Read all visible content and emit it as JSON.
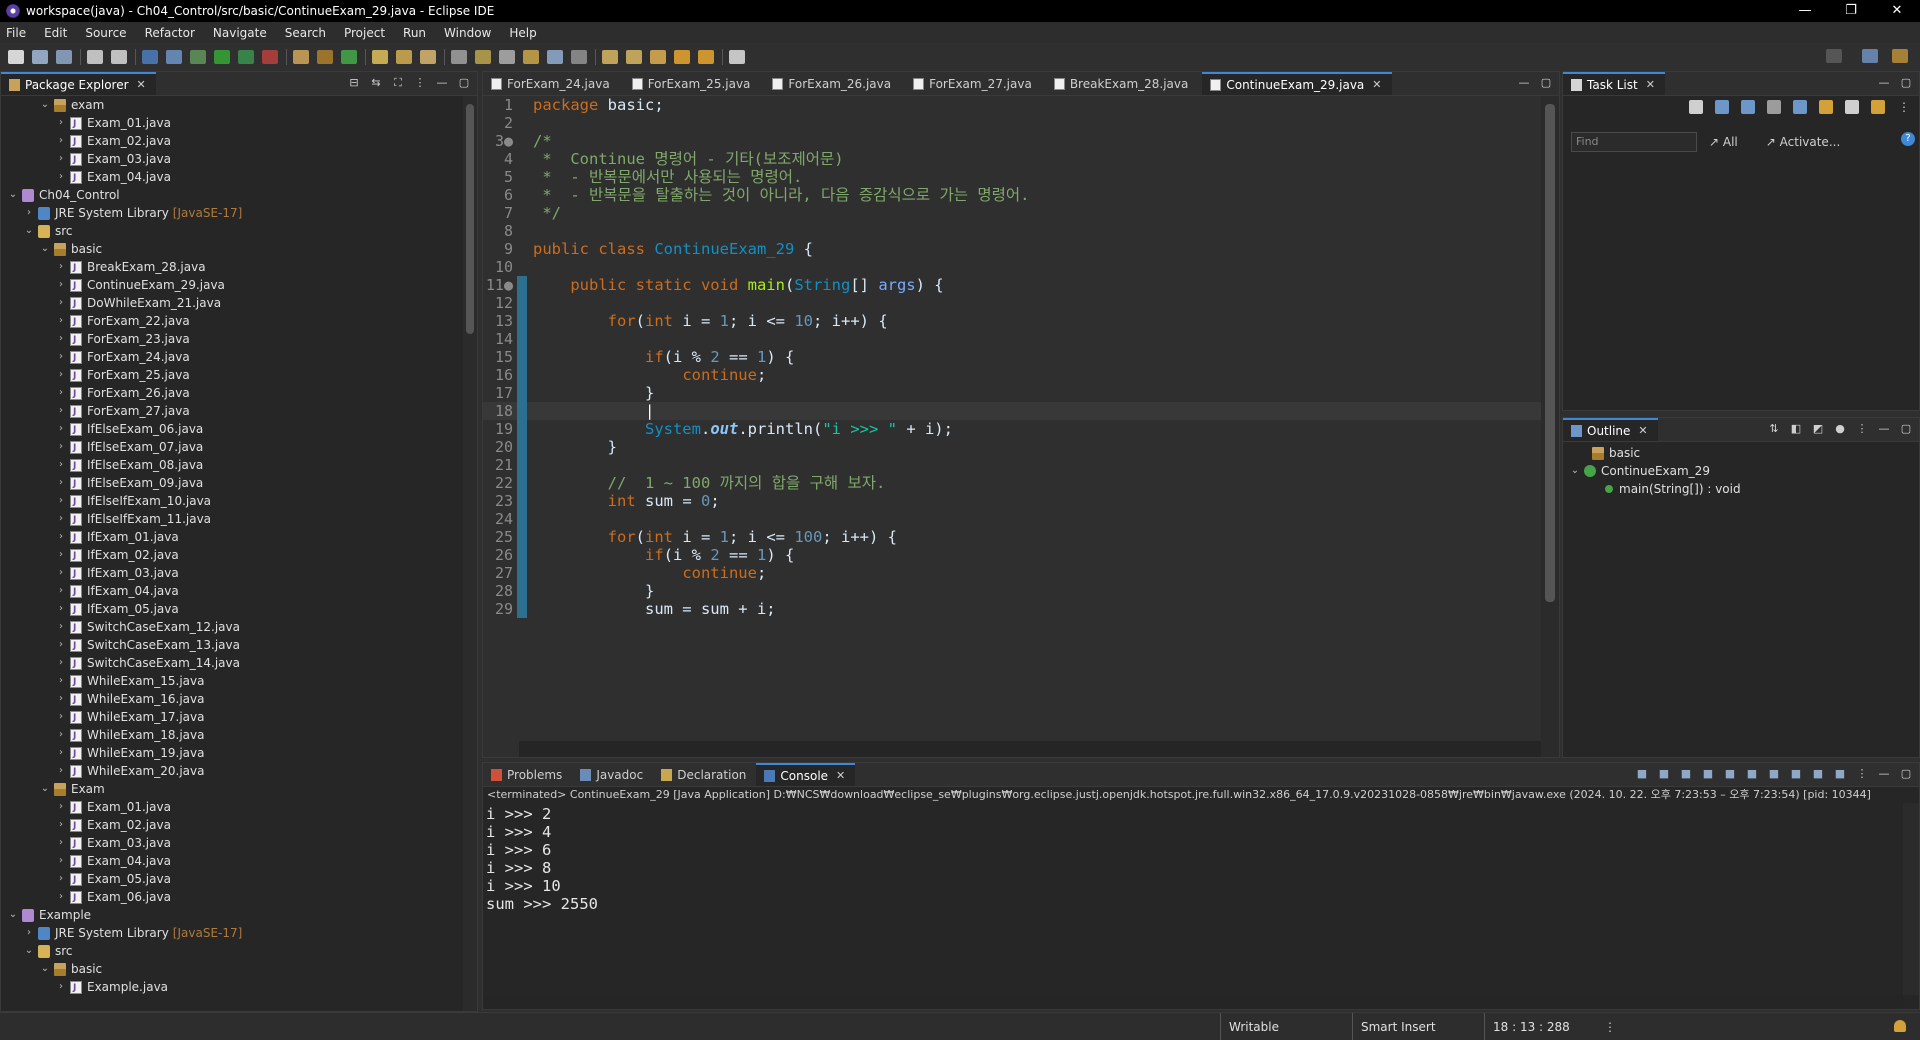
{
  "window": {
    "title": "workspace(java) - Ch04_Control/src/basic/ContinueExam_29.java - Eclipse IDE",
    "minimize": "—",
    "maximize": "❐",
    "close": "✕"
  },
  "menu": [
    "File",
    "Edit",
    "Source",
    "Refactor",
    "Navigate",
    "Search",
    "Project",
    "Run",
    "Window",
    "Help"
  ],
  "package_explorer": {
    "tab_label": "Package Explorer",
    "tree": [
      {
        "indent": 2,
        "arrow": "⌄",
        "icon": "pkg",
        "label": "exam"
      },
      {
        "indent": 3,
        "arrow": "›",
        "icon": "java",
        "label": "Exam_01.java"
      },
      {
        "indent": 3,
        "arrow": "›",
        "icon": "java",
        "label": "Exam_02.java"
      },
      {
        "indent": 3,
        "arrow": "›",
        "icon": "java",
        "label": "Exam_03.java"
      },
      {
        "indent": 3,
        "arrow": "›",
        "icon": "java",
        "label": "Exam_04.java"
      },
      {
        "indent": 0,
        "arrow": "⌄",
        "icon": "proj",
        "label": "Ch04_Control"
      },
      {
        "indent": 1,
        "arrow": "›",
        "icon": "jre",
        "label": "JRE System Library",
        "deco": "[JavaSE-17]"
      },
      {
        "indent": 1,
        "arrow": "⌄",
        "icon": "src",
        "label": "src"
      },
      {
        "indent": 2,
        "arrow": "⌄",
        "icon": "pkg",
        "label": "basic"
      },
      {
        "indent": 3,
        "arrow": "›",
        "icon": "java",
        "label": "BreakExam_28.java"
      },
      {
        "indent": 3,
        "arrow": "›",
        "icon": "java",
        "label": "ContinueExam_29.java"
      },
      {
        "indent": 3,
        "arrow": "›",
        "icon": "java",
        "label": "DoWhileExam_21.java"
      },
      {
        "indent": 3,
        "arrow": "›",
        "icon": "java",
        "label": "ForExam_22.java"
      },
      {
        "indent": 3,
        "arrow": "›",
        "icon": "java",
        "label": "ForExam_23.java"
      },
      {
        "indent": 3,
        "arrow": "›",
        "icon": "java",
        "label": "ForExam_24.java"
      },
      {
        "indent": 3,
        "arrow": "›",
        "icon": "java",
        "label": "ForExam_25.java"
      },
      {
        "indent": 3,
        "arrow": "›",
        "icon": "java",
        "label": "ForExam_26.java"
      },
      {
        "indent": 3,
        "arrow": "›",
        "icon": "java",
        "label": "ForExam_27.java"
      },
      {
        "indent": 3,
        "arrow": "›",
        "icon": "java",
        "label": "IfElseExam_06.java"
      },
      {
        "indent": 3,
        "arrow": "›",
        "icon": "java",
        "label": "IfElseExam_07.java"
      },
      {
        "indent": 3,
        "arrow": "›",
        "icon": "java",
        "label": "IfElseExam_08.java"
      },
      {
        "indent": 3,
        "arrow": "›",
        "icon": "java",
        "label": "IfElseExam_09.java"
      },
      {
        "indent": 3,
        "arrow": "›",
        "icon": "java",
        "label": "IfElseIfExam_10.java"
      },
      {
        "indent": 3,
        "arrow": "›",
        "icon": "java",
        "label": "IfElseIfExam_11.java"
      },
      {
        "indent": 3,
        "arrow": "›",
        "icon": "java",
        "label": "IfExam_01.java"
      },
      {
        "indent": 3,
        "arrow": "›",
        "icon": "java",
        "label": "IfExam_02.java"
      },
      {
        "indent": 3,
        "arrow": "›",
        "icon": "java",
        "label": "IfExam_03.java"
      },
      {
        "indent": 3,
        "arrow": "›",
        "icon": "java",
        "label": "IfExam_04.java"
      },
      {
        "indent": 3,
        "arrow": "›",
        "icon": "java",
        "label": "IfExam_05.java"
      },
      {
        "indent": 3,
        "arrow": "›",
        "icon": "java",
        "label": "SwitchCaseExam_12.java"
      },
      {
        "indent": 3,
        "arrow": "›",
        "icon": "java",
        "label": "SwitchCaseExam_13.java"
      },
      {
        "indent": 3,
        "arrow": "›",
        "icon": "java",
        "label": "SwitchCaseExam_14.java"
      },
      {
        "indent": 3,
        "arrow": "›",
        "icon": "java",
        "label": "WhileExam_15.java"
      },
      {
        "indent": 3,
        "arrow": "›",
        "icon": "java",
        "label": "WhileExam_16.java"
      },
      {
        "indent": 3,
        "arrow": "›",
        "icon": "java",
        "label": "WhileExam_17.java"
      },
      {
        "indent": 3,
        "arrow": "›",
        "icon": "java",
        "label": "WhileExam_18.java"
      },
      {
        "indent": 3,
        "arrow": "›",
        "icon": "java",
        "label": "WhileExam_19.java"
      },
      {
        "indent": 3,
        "arrow": "›",
        "icon": "java",
        "label": "WhileExam_20.java"
      },
      {
        "indent": 2,
        "arrow": "⌄",
        "icon": "pkg",
        "label": "Exam"
      },
      {
        "indent": 3,
        "arrow": "›",
        "icon": "java",
        "label": "Exam_01.java"
      },
      {
        "indent": 3,
        "arrow": "›",
        "icon": "java",
        "label": "Exam_02.java"
      },
      {
        "indent": 3,
        "arrow": "›",
        "icon": "java",
        "label": "Exam_03.java"
      },
      {
        "indent": 3,
        "arrow": "›",
        "icon": "java",
        "label": "Exam_04.java"
      },
      {
        "indent": 3,
        "arrow": "›",
        "icon": "java",
        "label": "Exam_05.java"
      },
      {
        "indent": 3,
        "arrow": "›",
        "icon": "java",
        "label": "Exam_06.java"
      },
      {
        "indent": 0,
        "arrow": "⌄",
        "icon": "proj",
        "label": "Example"
      },
      {
        "indent": 1,
        "arrow": "›",
        "icon": "jre",
        "label": "JRE System Library",
        "deco": "[JavaSE-17]"
      },
      {
        "indent": 1,
        "arrow": "⌄",
        "icon": "src",
        "label": "src"
      },
      {
        "indent": 2,
        "arrow": "⌄",
        "icon": "pkg",
        "label": "basic"
      },
      {
        "indent": 3,
        "arrow": "›",
        "icon": "java",
        "label": "Example.java"
      }
    ]
  },
  "editor": {
    "tabs": [
      {
        "label": "ForExam_24.java",
        "active": false
      },
      {
        "label": "ForExam_25.java",
        "active": false
      },
      {
        "label": "ForExam_26.java",
        "active": false
      },
      {
        "label": "ForExam_27.java",
        "active": false
      },
      {
        "label": "BreakExam_28.java",
        "active": false
      },
      {
        "label": "ContinueExam_29.java",
        "active": true
      }
    ],
    "lines": [
      {
        "n": "1",
        "tokens": [
          [
            "kw",
            "package"
          ],
          [
            "t",
            " basic;"
          ]
        ]
      },
      {
        "n": "2",
        "tokens": []
      },
      {
        "n": "3●",
        "tokens": [
          [
            "cm",
            "/*"
          ]
        ]
      },
      {
        "n": "4",
        "tokens": [
          [
            "cm",
            " *  Continue 명령어 - 기타(보조제어문)"
          ]
        ]
      },
      {
        "n": "5",
        "tokens": [
          [
            "cm",
            " *  - 반복문에서만 사용되는 명령어."
          ]
        ]
      },
      {
        "n": "6",
        "tokens": [
          [
            "cm",
            " *  - 반복문을 탈출하는 것이 아니라, 다음 증감식으로 가는 명령어."
          ]
        ]
      },
      {
        "n": "7",
        "tokens": [
          [
            "cm",
            " */"
          ]
        ]
      },
      {
        "n": "8",
        "tokens": []
      },
      {
        "n": "9",
        "tokens": [
          [
            "kw",
            "public class "
          ],
          [
            "cls",
            "ContinueExam_29"
          ],
          [
            "t",
            " {"
          ]
        ]
      },
      {
        "n": "10",
        "tokens": []
      },
      {
        "n": "11●",
        "tokens": [
          [
            "t",
            "    "
          ],
          [
            "kw",
            "public static void "
          ],
          [
            "fn",
            "main"
          ],
          [
            "t",
            "("
          ],
          [
            "cls",
            "String"
          ],
          [
            "t",
            "[] "
          ],
          [
            "var",
            "args"
          ],
          [
            "t",
            ") {"
          ]
        ]
      },
      {
        "n": "12",
        "tokens": []
      },
      {
        "n": "13",
        "tokens": [
          [
            "t",
            "        "
          ],
          [
            "kw",
            "for"
          ],
          [
            "t",
            "("
          ],
          [
            "kw",
            "int"
          ],
          [
            "t",
            " i = "
          ],
          [
            "num",
            "1"
          ],
          [
            "t",
            "; i <= "
          ],
          [
            "num",
            "10"
          ],
          [
            "t",
            "; i++) {"
          ]
        ]
      },
      {
        "n": "14",
        "tokens": []
      },
      {
        "n": "15",
        "tokens": [
          [
            "t",
            "            "
          ],
          [
            "kw",
            "if"
          ],
          [
            "t",
            "(i % "
          ],
          [
            "num",
            "2"
          ],
          [
            "t",
            " == "
          ],
          [
            "num",
            "1"
          ],
          [
            "t",
            ") {"
          ]
        ]
      },
      {
        "n": "16",
        "tokens": [
          [
            "t",
            "                "
          ],
          [
            "kw",
            "continue"
          ],
          [
            "t",
            ";"
          ]
        ]
      },
      {
        "n": "17",
        "tokens": [
          [
            "t",
            "            }"
          ]
        ]
      },
      {
        "n": "18",
        "tokens": [
          [
            "t",
            "            "
          ],
          [
            "cursor",
            "|"
          ]
        ],
        "current": true
      },
      {
        "n": "19",
        "tokens": [
          [
            "t",
            "            "
          ],
          [
            "cls",
            "System"
          ],
          [
            "t",
            "."
          ],
          [
            "field",
            "out"
          ],
          [
            "t",
            ".println("
          ],
          [
            "str",
            "\"i >>> \""
          ],
          [
            "t",
            " + i);"
          ]
        ]
      },
      {
        "n": "20",
        "tokens": [
          [
            "t",
            "        }"
          ]
        ]
      },
      {
        "n": "21",
        "tokens": []
      },
      {
        "n": "22",
        "tokens": [
          [
            "t",
            "        "
          ],
          [
            "cm",
            "//  1 ~ 100 까지의 합을 구해 보자."
          ]
        ]
      },
      {
        "n": "23",
        "tokens": [
          [
            "t",
            "        "
          ],
          [
            "kw",
            "int"
          ],
          [
            "t",
            " sum = "
          ],
          [
            "num",
            "0"
          ],
          [
            "t",
            ";"
          ]
        ]
      },
      {
        "n": "24",
        "tokens": []
      },
      {
        "n": "25",
        "tokens": [
          [
            "t",
            "        "
          ],
          [
            "kw",
            "for"
          ],
          [
            "t",
            "("
          ],
          [
            "kw",
            "int"
          ],
          [
            "t",
            " i = "
          ],
          [
            "num",
            "1"
          ],
          [
            "t",
            "; i <= "
          ],
          [
            "num",
            "100"
          ],
          [
            "t",
            "; i++) {"
          ]
        ]
      },
      {
        "n": "26",
        "tokens": [
          [
            "t",
            "            "
          ],
          [
            "kw",
            "if"
          ],
          [
            "t",
            "(i % "
          ],
          [
            "num",
            "2"
          ],
          [
            "t",
            " == "
          ],
          [
            "num",
            "1"
          ],
          [
            "t",
            ") {"
          ]
        ]
      },
      {
        "n": "27",
        "tokens": [
          [
            "t",
            "                "
          ],
          [
            "kw",
            "continue"
          ],
          [
            "t",
            ";"
          ]
        ]
      },
      {
        "n": "28",
        "tokens": [
          [
            "t",
            "            }"
          ]
        ]
      },
      {
        "n": "29",
        "tokens": [
          [
            "t",
            "            sum = sum + i;"
          ]
        ]
      }
    ]
  },
  "task_list": {
    "tab_label": "Task List",
    "find_placeholder": "Find",
    "all_label": "All",
    "activate_label": "Activate..."
  },
  "outline": {
    "tab_label": "Outline",
    "items": [
      {
        "label": "basic"
      },
      {
        "label": "ContinueExam_29"
      },
      {
        "label": "main(String[]) : void"
      }
    ]
  },
  "bottom_panel": {
    "tabs": [
      {
        "label": "Problems",
        "active": false
      },
      {
        "label": "Javadoc",
        "active": false
      },
      {
        "label": "Declaration",
        "active": false
      },
      {
        "label": "Console",
        "active": true
      }
    ],
    "console_header": "<terminated> ContinueExam_29 [Java Application] D:₩NCS₩download₩eclipse_se₩plugins₩org.eclipse.justj.openjdk.hotspot.jre.full.win32.x86_64_17.0.9.v20231028-0858₩jre₩bin₩javaw.exe  (2024. 10. 22. 오후 7:23:53 – 오후 7:23:54) [pid: 10344]",
    "output": [
      "i >>> 2",
      "i >>> 4",
      "i >>> 6",
      "i >>> 8",
      "i >>> 10",
      "sum >>> 2550"
    ]
  },
  "status": {
    "writable": "Writable",
    "insert_mode": "Smart Insert",
    "position": "18 : 13 : 288"
  },
  "colors": {
    "keyword": "#cc6c1d",
    "comment": "#80a86b",
    "class": "#1290c3",
    "string": "#17c6a3",
    "number": "#6897bb",
    "method": "#a7ec21",
    "field": "#8dc6f5",
    "variable": "#79abff",
    "accent": "#3f88d8"
  }
}
